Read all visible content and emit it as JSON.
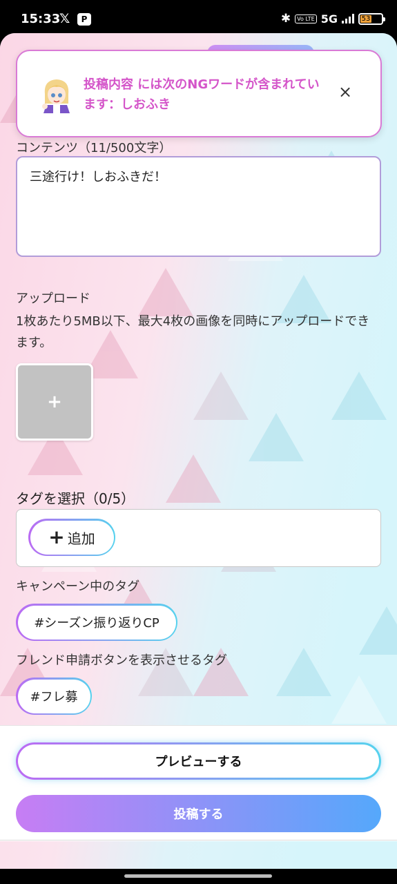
{
  "status_bar": {
    "time": "15:33",
    "x_app": "𝕏",
    "p_app": "P",
    "network": "5G",
    "volte": "Vo LTE",
    "battery": "53"
  },
  "toast": {
    "message": "投稿内容 には次のNGワードが含まれています：しおふき",
    "close_icon": "×"
  },
  "content": {
    "label": "コンテンツ（11/500文字）",
    "value": "三途行け！しおふきだ！"
  },
  "upload": {
    "title": "アップロード",
    "description": "1枚あたり5MB以下、最大4枚の画像を同時にアップロードできます。",
    "add_symbol": "+"
  },
  "tags": {
    "title": "タグを選択（0/5）",
    "add_plus": "+",
    "add_label": "追加",
    "campaign_label": "キャンペーン中のタグ",
    "campaign_tag": "#シーズン振り返りCP",
    "friend_label": "フレンド申請ボタンを表示させるタグ",
    "friend_tag": "#フレ募"
  },
  "footer": {
    "preview_label": "プレビューする",
    "post_label": "投稿する"
  },
  "colors": {
    "accent_purple": "#bb6bf3",
    "accent_cyan": "#56d2ee",
    "toast_text": "#d455c9"
  }
}
